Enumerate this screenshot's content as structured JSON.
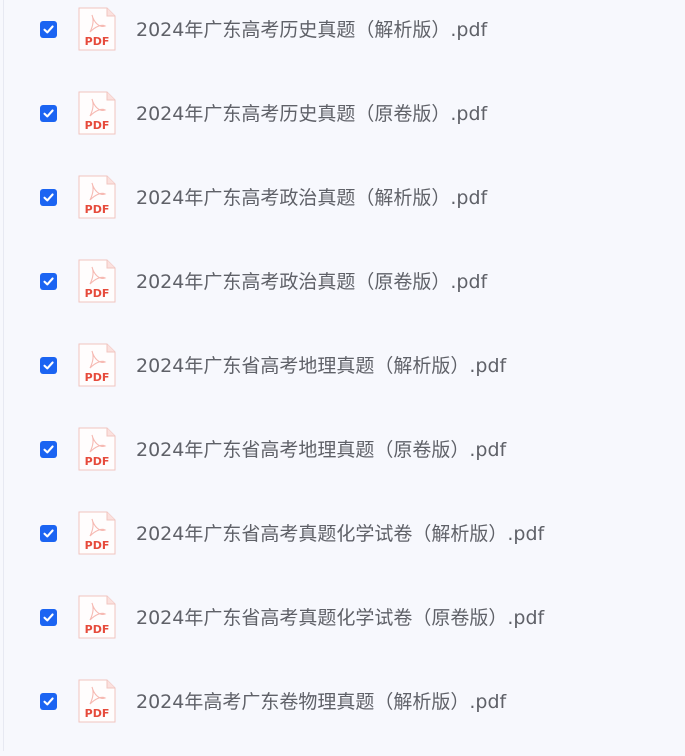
{
  "files": [
    {
      "name": "2024年广东高考历史真题（解析版）.pdf",
      "checked": true,
      "icon": "pdf-file-icon",
      "icon_label": "PDF"
    },
    {
      "name": "2024年广东高考历史真题（原卷版）.pdf",
      "checked": true,
      "icon": "pdf-file-icon",
      "icon_label": "PDF"
    },
    {
      "name": "2024年广东高考政治真题（解析版）.pdf",
      "checked": true,
      "icon": "pdf-file-icon",
      "icon_label": "PDF"
    },
    {
      "name": "2024年广东高考政治真题（原卷版）.pdf",
      "checked": true,
      "icon": "pdf-file-icon",
      "icon_label": "PDF"
    },
    {
      "name": "2024年广东省高考地理真题（解析版）.pdf",
      "checked": true,
      "icon": "pdf-file-icon",
      "icon_label": "PDF"
    },
    {
      "name": "2024年广东省高考地理真题（原卷版）.pdf",
      "checked": true,
      "icon": "pdf-file-icon",
      "icon_label": "PDF"
    },
    {
      "name": "2024年广东省高考真题化学试卷（解析版）.pdf",
      "checked": true,
      "icon": "pdf-file-icon",
      "icon_label": "PDF"
    },
    {
      "name": "2024年广东省高考真题化学试卷（原卷版）.pdf",
      "checked": true,
      "icon": "pdf-file-icon",
      "icon_label": "PDF"
    },
    {
      "name": "2024年高考广东卷物理真题（解析版）.pdf",
      "checked": true,
      "icon": "pdf-file-icon",
      "icon_label": "PDF"
    }
  ],
  "colors": {
    "background": "#f7f8fd",
    "checkbox": "#1b64f2",
    "pdf_red": "#e64a3b",
    "text": "#5f6168"
  }
}
